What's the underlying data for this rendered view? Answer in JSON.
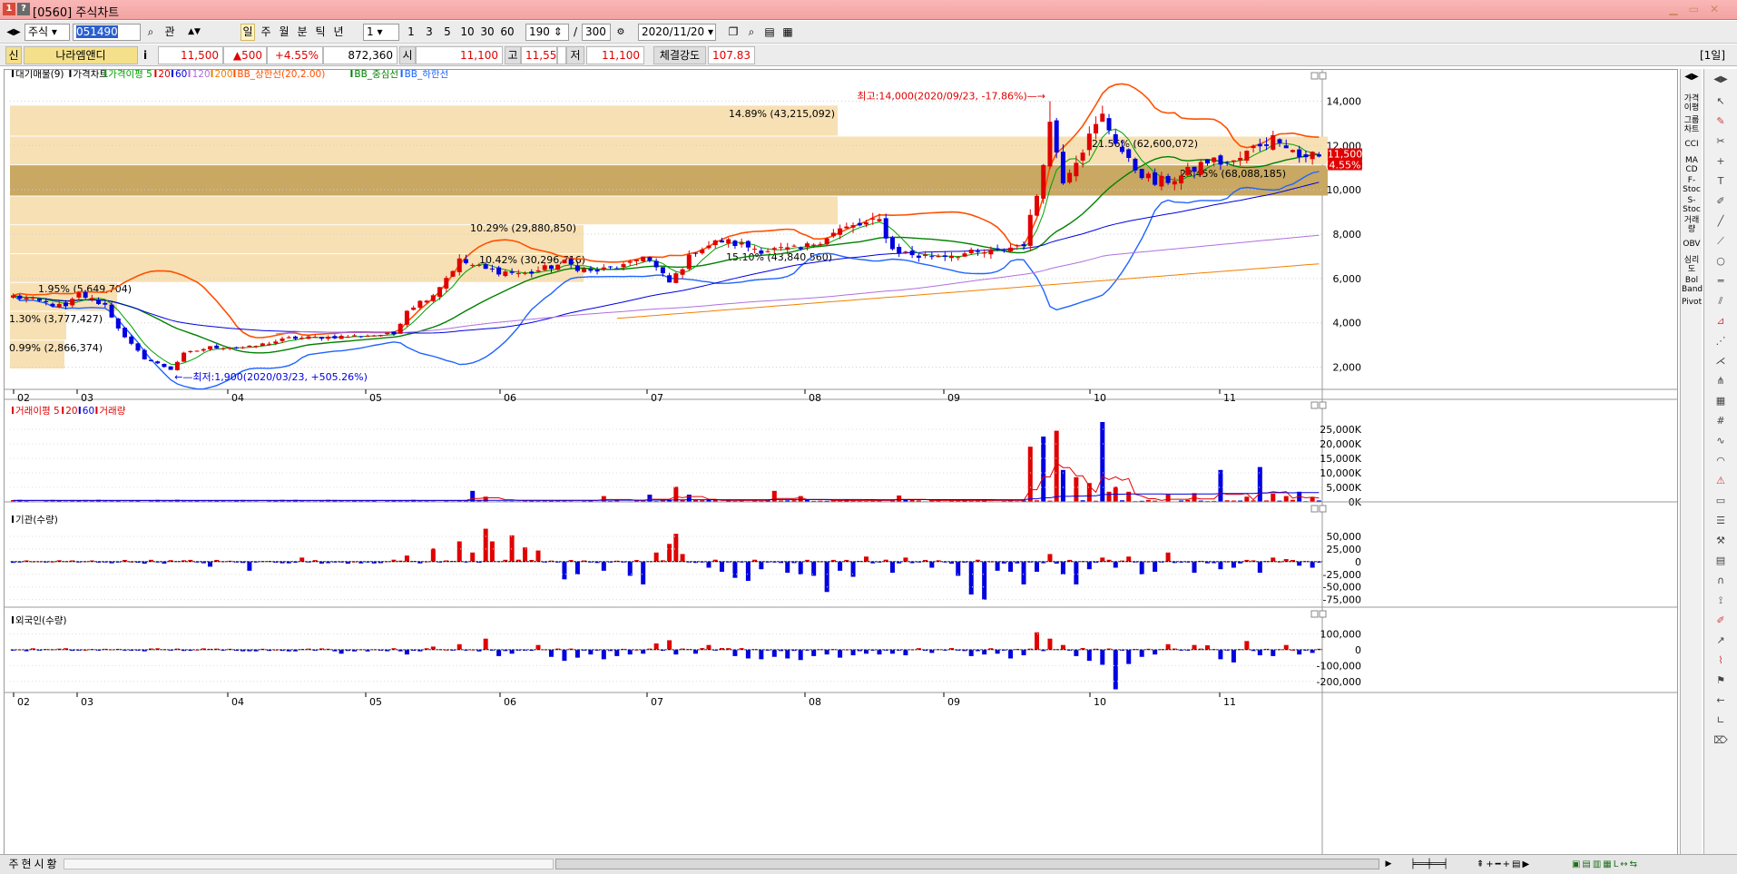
{
  "window": {
    "screen_no": "0560",
    "title": "[0560] 주식차트"
  },
  "toolbar": {
    "market": "주식",
    "code": "051490",
    "btn_group": "관",
    "periods": [
      "일",
      "주",
      "월",
      "분",
      "틱",
      "년"
    ],
    "active_period": "일",
    "interval": "1",
    "minute_buttons": [
      "1",
      "3",
      "5",
      "10",
      "30",
      "60"
    ],
    "count": "190",
    "count_total": "300",
    "date": "2020/11/20"
  },
  "quote": {
    "flag": "신",
    "name": "나라엠앤디",
    "info_btn": "i",
    "price": "11,500",
    "change": "▲500",
    "change_pct": "+4.55%",
    "volume": "872,360",
    "open_label": "시",
    "open": "11,100",
    "high_label": "고",
    "high": "11,550",
    "low_label": "저",
    "low": "11,100",
    "strength_label": "체결강도",
    "strength": "107.83",
    "period_badge": "[1일]"
  },
  "legends": {
    "price": [
      {
        "text": "대기매물(9)",
        "color": "#000000"
      },
      {
        "text": "가격차트",
        "color": "#000000"
      },
      {
        "text": "가격이평 5",
        "color": "#00a000"
      },
      {
        "text": "20",
        "color": "#e00000"
      },
      {
        "text": "60",
        "color": "#0000e0"
      },
      {
        "text": "120",
        "color": "#b070e0"
      },
      {
        "text": "200",
        "color": "#f08000"
      },
      {
        "text": "BB_상한선(20,2.00)",
        "color": "#ff5000"
      },
      {
        "text": "BB_중심선",
        "color": "#008000"
      },
      {
        "text": "BB_하한선",
        "color": "#1e64ff"
      }
    ],
    "volume": [
      {
        "text": "거래이평 5",
        "color": "#e00000"
      },
      {
        "text": "20",
        "color": "#e00000"
      },
      {
        "text": "60",
        "color": "#0000e0"
      },
      {
        "text": "거래량",
        "color": "#e00000"
      }
    ],
    "institution": [
      {
        "text": "기관(수량)",
        "color": "#000000"
      }
    ],
    "foreign": [
      {
        "text": "외국인(수량)",
        "color": "#000000"
      }
    ]
  },
  "annotations": {
    "high": "최고:14,000(2020/09/23, -17.86%)",
    "low": "최저:1,900(2020/03/23, +505.26%)",
    "last_price": "11,500",
    "last_pct": "(4.55%)"
  },
  "right_toolbar": [
    "가격\n이평",
    "그룹\n차트",
    "CCI",
    "MA\nCD",
    "F-\nStoc",
    "S-\nStoc",
    "거래\n량",
    "OBV",
    "심리\n도",
    "Bol\nBand",
    "Pivot"
  ],
  "bottom_bar": {
    "tabs": [
      "주",
      "현",
      "시",
      "황"
    ]
  },
  "chart_data": [
    {
      "type": "candlestick",
      "title": "가격차트",
      "x_tick_labels": [
        "02",
        "03",
        "04",
        "05",
        "06",
        "07",
        "08",
        "09",
        "10",
        "11"
      ],
      "ylim": [
        1000,
        15000
      ],
      "y_ticks": [
        2000,
        4000,
        6000,
        8000,
        10000,
        12000,
        14000
      ],
      "y_tick_labels": [
        "2,000",
        "4,000",
        "6,000",
        "8,000",
        "10,000",
        "12,000",
        "14,000"
      ],
      "last_close": 11500,
      "high_point": {
        "date": "2020/09/23",
        "value": 14000
      },
      "low_point": {
        "date": "2020/03/23",
        "value": 1900
      },
      "volume_profile": [
        {
          "label": "14.89% (43,215,092)",
          "price_low": 12400,
          "price_high": 13800
        },
        {
          "label": "",
          "price_low": 11100,
          "price_high": 12400
        },
        {
          "label": "",
          "price_low": 9700,
          "price_high": 11100
        },
        {
          "label": "23.45% (68,088,185)",
          "price_low": 9700,
          "price_high": 11100
        },
        {
          "label": "15.10% (43,840,560)",
          "price_low": 8400,
          "price_high": 9700
        },
        {
          "label": "10.29% (29,880,850)",
          "price_low": 7100,
          "price_high": 8400
        },
        {
          "label": "10.42% (30,296,716)",
          "price_low": 5800,
          "price_high": 7100
        },
        {
          "label": "1.95% (5,649,704)",
          "price_low": 4500,
          "price_high": 5800
        },
        {
          "label": "1.30% (3,777,427)",
          "price_low": 3200,
          "price_high": 4500
        },
        {
          "label": "0.99% (2,866,374)",
          "price_low": 1900,
          "price_high": 3200
        },
        {
          "label": "21.56% (62,600,072)",
          "price_low": 11100,
          "price_high": 12400
        }
      ],
      "anchors": [
        [
          0,
          5200
        ],
        [
          8,
          4700
        ],
        [
          10,
          5300
        ],
        [
          14,
          4800
        ],
        [
          17,
          3300
        ],
        [
          20,
          2400
        ],
        [
          24,
          1900
        ],
        [
          26,
          2600
        ],
        [
          30,
          2900
        ],
        [
          36,
          2900
        ],
        [
          42,
          3300
        ],
        [
          52,
          3400
        ],
        [
          58,
          3500
        ],
        [
          60,
          4600
        ],
        [
          64,
          5300
        ],
        [
          68,
          6800
        ],
        [
          72,
          6400
        ],
        [
          78,
          6200
        ],
        [
          84,
          6700
        ],
        [
          88,
          6300
        ],
        [
          94,
          6600
        ],
        [
          96,
          7100
        ],
        [
          100,
          5800
        ],
        [
          104,
          7300
        ],
        [
          108,
          7700
        ],
        [
          114,
          7300
        ],
        [
          120,
          7300
        ],
        [
          126,
          8200
        ],
        [
          132,
          8600
        ],
        [
          134,
          7300
        ],
        [
          138,
          7000
        ],
        [
          144,
          7100
        ],
        [
          150,
          7200
        ],
        [
          154,
          7600
        ],
        [
          156,
          9800
        ],
        [
          158,
          13000
        ],
        [
          160,
          10500
        ],
        [
          166,
          13300
        ],
        [
          170,
          11200
        ],
        [
          174,
          10300
        ],
        [
          178,
          10600
        ],
        [
          182,
          11300
        ],
        [
          186,
          11200
        ],
        [
          190,
          12100
        ],
        [
          193,
          12400
        ],
        [
          196,
          11500
        ],
        [
          198,
          11600
        ]
      ],
      "series": [
        {
          "name": "가격이평 5",
          "color": "#00a000"
        },
        {
          "name": "20",
          "color": "#e00000"
        },
        {
          "name": "60",
          "color": "#0000e0"
        },
        {
          "name": "120",
          "color": "#b070e0"
        },
        {
          "name": "200",
          "color": "#f08000"
        },
        {
          "name": "BB_상한선(20,2.00)",
          "color": "#ff5000"
        },
        {
          "name": "BB_중심선",
          "color": "#008000"
        },
        {
          "name": "BB_하한선",
          "color": "#1e64ff"
        }
      ]
    },
    {
      "type": "bar",
      "title": "거래량",
      "ylim": [
        0,
        30000
      ],
      "y_tick_labels": [
        "0K",
        "5,000K",
        "10,000K",
        "15,000K",
        "20,000K",
        "25,000K"
      ],
      "spikes": [
        [
          70,
          3800
        ],
        [
          72,
          1800
        ],
        [
          90,
          2000
        ],
        [
          97,
          2500
        ],
        [
          101,
          5200
        ],
        [
          103,
          2500
        ],
        [
          116,
          3800
        ],
        [
          120,
          2000
        ],
        [
          135,
          2200
        ],
        [
          155,
          19000
        ],
        [
          157,
          22500
        ],
        [
          159,
          24500
        ],
        [
          160,
          11000
        ],
        [
          162,
          8500
        ],
        [
          164,
          6500
        ],
        [
          166,
          27500
        ],
        [
          167,
          3500
        ],
        [
          168,
          5200
        ],
        [
          170,
          3500
        ],
        [
          176,
          2500
        ],
        [
          180,
          3000
        ],
        [
          184,
          11000
        ],
        [
          188,
          1800
        ],
        [
          190,
          12000
        ],
        [
          192,
          2800
        ],
        [
          194,
          2000
        ],
        [
          196,
          3500
        ],
        [
          198,
          1600
        ]
      ]
    },
    {
      "type": "bar",
      "title": "기관(수량)",
      "ylim": [
        -90000,
        75000
      ],
      "y_tick_labels": [
        "-75,000",
        "-50,000",
        "-25,000",
        "0",
        "25,000",
        "50,000"
      ],
      "spikes": [
        [
          30,
          -10000
        ],
        [
          36,
          -18000
        ],
        [
          44,
          8000
        ],
        [
          48,
          -3000
        ],
        [
          60,
          12000
        ],
        [
          64,
          26000
        ],
        [
          68,
          40000
        ],
        [
          70,
          18000
        ],
        [
          72,
          65000
        ],
        [
          73,
          40000
        ],
        [
          76,
          52000
        ],
        [
          78,
          28000
        ],
        [
          80,
          22000
        ],
        [
          84,
          -35000
        ],
        [
          86,
          -25000
        ],
        [
          90,
          -18000
        ],
        [
          94,
          -28000
        ],
        [
          96,
          -45000
        ],
        [
          98,
          18000
        ],
        [
          100,
          35000
        ],
        [
          101,
          55000
        ],
        [
          102,
          15000
        ],
        [
          106,
          -12000
        ],
        [
          108,
          -20000
        ],
        [
          110,
          -32000
        ],
        [
          112,
          -38000
        ],
        [
          114,
          -15000
        ],
        [
          118,
          -22000
        ],
        [
          120,
          -25000
        ],
        [
          122,
          -28000
        ],
        [
          124,
          -60000
        ],
        [
          126,
          -18000
        ],
        [
          128,
          -30000
        ],
        [
          130,
          10000
        ],
        [
          134,
          -22000
        ],
        [
          136,
          8000
        ],
        [
          140,
          -12000
        ],
        [
          144,
          -28000
        ],
        [
          146,
          -65000
        ],
        [
          148,
          -75000
        ],
        [
          150,
          -18000
        ],
        [
          152,
          -20000
        ],
        [
          154,
          -45000
        ],
        [
          156,
          -20000
        ],
        [
          158,
          15000
        ],
        [
          160,
          -25000
        ],
        [
          162,
          -45000
        ],
        [
          164,
          -15000
        ],
        [
          166,
          8000
        ],
        [
          168,
          -12000
        ],
        [
          170,
          10000
        ],
        [
          172,
          -25000
        ],
        [
          174,
          -20000
        ],
        [
          176,
          18000
        ],
        [
          180,
          -22000
        ],
        [
          184,
          -15000
        ],
        [
          186,
          -12000
        ],
        [
          190,
          -22000
        ],
        [
          192,
          8000
        ],
        [
          194,
          5000
        ],
        [
          196,
          -8000
        ],
        [
          198,
          -12000
        ]
      ]
    },
    {
      "type": "bar",
      "title": "외국인(수량)",
      "ylim": [
        -270000,
        160000
      ],
      "y_tick_labels": [
        "-200,000",
        "-100,000",
        "0",
        "100,000"
      ],
      "spikes": [
        [
          50,
          -25000
        ],
        [
          60,
          -30000
        ],
        [
          64,
          20000
        ],
        [
          68,
          35000
        ],
        [
          72,
          70000
        ],
        [
          74,
          -40000
        ],
        [
          76,
          -25000
        ],
        [
          80,
          30000
        ],
        [
          82,
          -45000
        ],
        [
          84,
          -70000
        ],
        [
          86,
          -50000
        ],
        [
          88,
          -30000
        ],
        [
          90,
          -60000
        ],
        [
          92,
          -40000
        ],
        [
          94,
          -30000
        ],
        [
          96,
          -25000
        ],
        [
          98,
          40000
        ],
        [
          100,
          60000
        ],
        [
          101,
          -30000
        ],
        [
          104,
          -25000
        ],
        [
          106,
          30000
        ],
        [
          110,
          -40000
        ],
        [
          112,
          -55000
        ],
        [
          114,
          -60000
        ],
        [
          116,
          -45000
        ],
        [
          118,
          -55000
        ],
        [
          120,
          -65000
        ],
        [
          122,
          -40000
        ],
        [
          124,
          -30000
        ],
        [
          126,
          -50000
        ],
        [
          128,
          -35000
        ],
        [
          130,
          -25000
        ],
        [
          132,
          -30000
        ],
        [
          134,
          -25000
        ],
        [
          136,
          -35000
        ],
        [
          140,
          -20000
        ],
        [
          146,
          -40000
        ],
        [
          148,
          -30000
        ],
        [
          150,
          -25000
        ],
        [
          152,
          -55000
        ],
        [
          154,
          -35000
        ],
        [
          156,
          110000
        ],
        [
          158,
          70000
        ],
        [
          160,
          30000
        ],
        [
          162,
          -40000
        ],
        [
          164,
          -70000
        ],
        [
          166,
          -95000
        ],
        [
          168,
          -250000
        ],
        [
          170,
          -90000
        ],
        [
          172,
          -45000
        ],
        [
          174,
          -30000
        ],
        [
          176,
          35000
        ],
        [
          180,
          30000
        ],
        [
          182,
          28000
        ],
        [
          184,
          -60000
        ],
        [
          186,
          -80000
        ],
        [
          188,
          55000
        ],
        [
          190,
          -35000
        ],
        [
          192,
          -40000
        ],
        [
          194,
          30000
        ],
        [
          196,
          -30000
        ],
        [
          198,
          -20000
        ]
      ]
    }
  ]
}
